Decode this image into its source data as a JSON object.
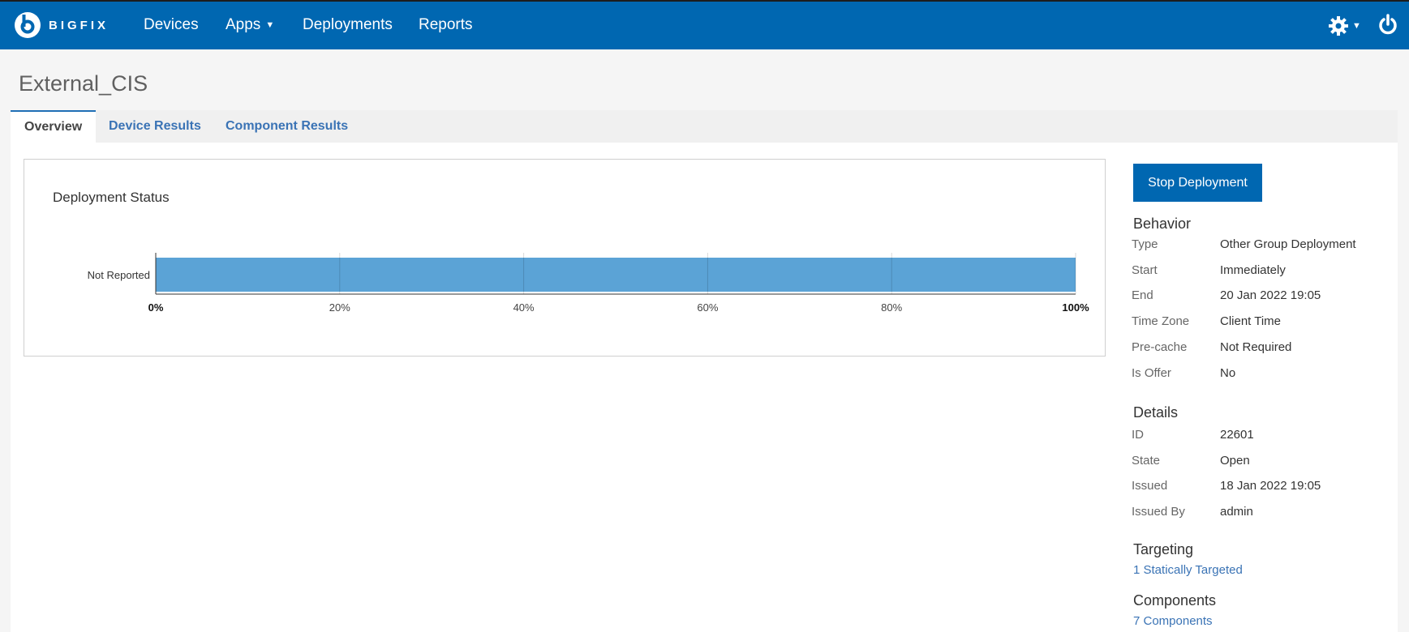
{
  "nav": {
    "brand": "BIGFIX",
    "items": [
      {
        "label": "Devices"
      },
      {
        "label": "Apps",
        "dropdown": true
      },
      {
        "label": "Deployments"
      },
      {
        "label": "Reports"
      }
    ],
    "icons": [
      "gear-icon",
      "power-icon"
    ],
    "bg_color": "#0067b1"
  },
  "page": {
    "title": "External_CIS"
  },
  "tabs": [
    {
      "label": "Overview",
      "active": true
    },
    {
      "label": "Device Results",
      "active": false
    },
    {
      "label": "Component Results",
      "active": false
    }
  ],
  "panel": {
    "title": "Deployment Status"
  },
  "chart_data": {
    "type": "bar",
    "orientation": "horizontal",
    "title": "Deployment Status",
    "categories": [
      "Not Reported"
    ],
    "values": [
      100
    ],
    "xlim": [
      0,
      100
    ],
    "x_ticks": [
      "0%",
      "20%",
      "40%",
      "60%",
      "80%",
      "100%"
    ],
    "grid": true,
    "bar_color": "#5ba3d6"
  },
  "sidebar": {
    "stop_button": "Stop Deployment",
    "behavior": {
      "title": "Behavior",
      "rows": [
        {
          "label": "Type",
          "value": "Other Group Deployment"
        },
        {
          "label": "Start",
          "value": "Immediately"
        },
        {
          "label": "End",
          "value": "20 Jan 2022 19:05"
        },
        {
          "label": "Time Zone",
          "value": "Client Time"
        },
        {
          "label": "Pre-cache",
          "value": "Not Required"
        },
        {
          "label": "Is Offer",
          "value": "No"
        }
      ]
    },
    "details": {
      "title": "Details",
      "rows": [
        {
          "label": "ID",
          "value": "22601"
        },
        {
          "label": "State",
          "value": "Open"
        },
        {
          "label": "Issued",
          "value": "18 Jan 2022 19:05"
        },
        {
          "label": "Issued By",
          "value": "admin"
        }
      ]
    },
    "targeting": {
      "title": "Targeting",
      "link": "1 Statically Targeted"
    },
    "components": {
      "title": "Components",
      "link": "7 Components"
    }
  }
}
